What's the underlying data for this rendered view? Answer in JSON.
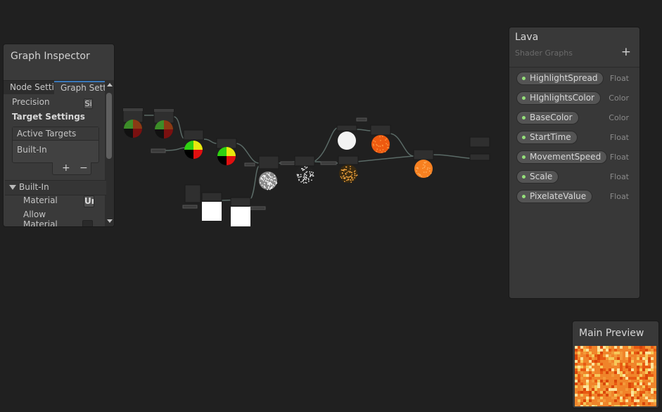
{
  "inspector": {
    "title": "Graph Inspector",
    "tabs": [
      "Node Setti",
      "Graph Setti"
    ],
    "precision_label": "Precision",
    "precision_value": "Si",
    "target_settings_label": "Target Settings",
    "active_targets_header": "Active Targets",
    "active_targets": [
      "Built-In"
    ],
    "add_symbol": "+",
    "remove_symbol": "−",
    "section_builtin": "Built-In",
    "material_label": "Material",
    "material_value": "Ur",
    "allow_material_label_line1": "Allow",
    "allow_material_label_line2": "Material"
  },
  "blackboard": {
    "title": "Lava",
    "subtitle": "Shader Graphs",
    "add_symbol": "+",
    "properties": [
      {
        "name": "HighlightSpread",
        "type": "Float"
      },
      {
        "name": "HIghlightsColor",
        "type": "Color"
      },
      {
        "name": "BaseColor",
        "type": "Color"
      },
      {
        "name": "StartTime",
        "type": "Float"
      },
      {
        "name": "MovementSpeed",
        "type": "Float"
      },
      {
        "name": "Scale",
        "type": "Float"
      },
      {
        "name": "PixelateValue",
        "type": "Float"
      }
    ]
  },
  "preview": {
    "title": "Main Preview"
  },
  "colors": {
    "background": "#202020",
    "panel": "#3a3a3a",
    "accent_tab": "#3a79bb",
    "property_dot": "#95e07a",
    "lava_orange": "#f0842a"
  }
}
